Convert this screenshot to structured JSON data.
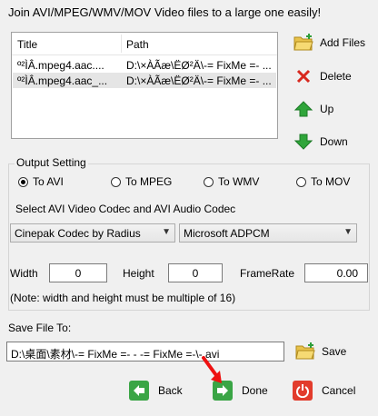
{
  "header": {
    "title": "Join AVI/MPEG/WMV/MOV  Video files to a large one easily!"
  },
  "file_list": {
    "columns": [
      "Title",
      "Path"
    ],
    "rows": [
      {
        "title": "º²ÌÂ.mpeg4.aac....",
        "path": "D:\\×ÀÃæ\\ËØ²Ä\\-= FixMe =- ..."
      },
      {
        "title": "º²ÌÂ.mpeg4.aac_...",
        "path": "D:\\×ÀÃæ\\ËØ²Ä\\-= FixMe =- ..."
      }
    ]
  },
  "side_buttons": {
    "add_files": "Add Files",
    "delete": "Delete",
    "up": "Up",
    "down": "Down"
  },
  "output": {
    "legend": "Output Setting",
    "options": [
      "To AVI",
      "To MPEG",
      "To WMV",
      "To MOV"
    ],
    "selected": "To AVI",
    "codec_label": "Select AVI Video Codec and AVI Audio Codec",
    "video_codec": "Cinepak Codec by Radius",
    "audio_codec": "Microsoft ADPCM",
    "width_label": "Width",
    "width_value": "0",
    "height_label": "Height",
    "height_value": "0",
    "framerate_label": "FrameRate",
    "framerate_value": "0.00",
    "note": "(Note: width and height must be multiple of 16)"
  },
  "save": {
    "label": "Save File To:",
    "path": "D:\\桌面\\素材\\-= FixMe =- - -= FixMe =-\\-.avi",
    "button": "Save"
  },
  "footer": {
    "back": "Back",
    "done": "Done",
    "cancel": "Cancel"
  },
  "colors": {
    "window_bg": "#f0f0f0",
    "selection": "#e5e5e5",
    "back_green": "#3aa545",
    "cancel_red": "#e23c2c"
  }
}
